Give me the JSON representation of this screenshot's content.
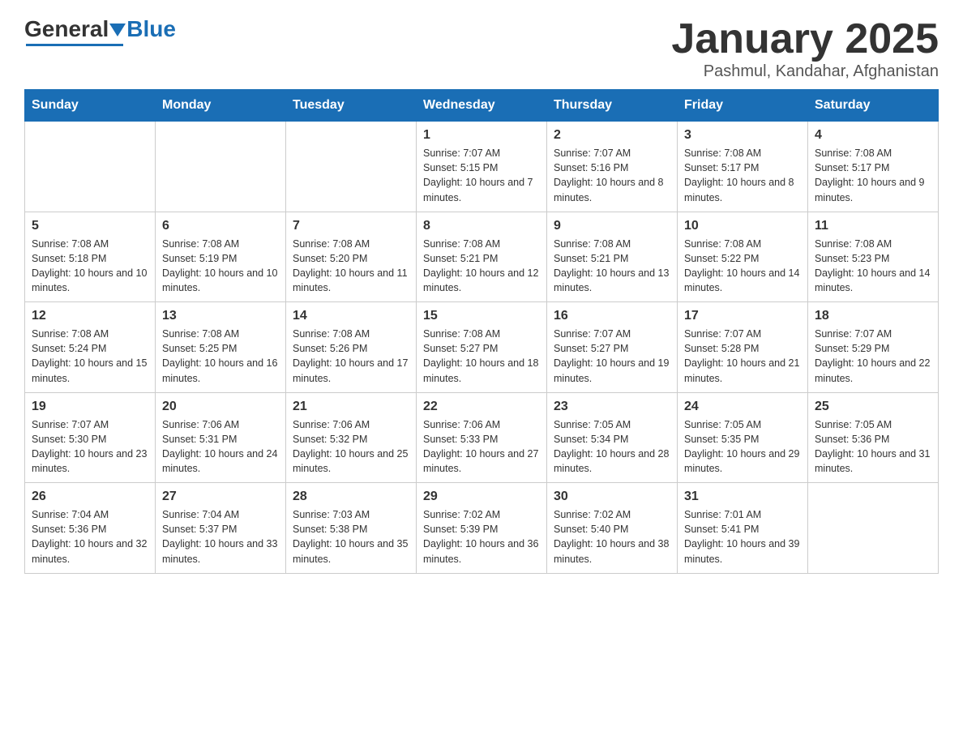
{
  "header": {
    "logo_general": "General",
    "logo_blue": "Blue",
    "title": "January 2025",
    "location": "Pashmul, Kandahar, Afghanistan"
  },
  "days_of_week": [
    "Sunday",
    "Monday",
    "Tuesday",
    "Wednesday",
    "Thursday",
    "Friday",
    "Saturday"
  ],
  "weeks": [
    [
      {
        "day": "",
        "info": ""
      },
      {
        "day": "",
        "info": ""
      },
      {
        "day": "",
        "info": ""
      },
      {
        "day": "1",
        "info": "Sunrise: 7:07 AM\nSunset: 5:15 PM\nDaylight: 10 hours and 7 minutes."
      },
      {
        "day": "2",
        "info": "Sunrise: 7:07 AM\nSunset: 5:16 PM\nDaylight: 10 hours and 8 minutes."
      },
      {
        "day": "3",
        "info": "Sunrise: 7:08 AM\nSunset: 5:17 PM\nDaylight: 10 hours and 8 minutes."
      },
      {
        "day": "4",
        "info": "Sunrise: 7:08 AM\nSunset: 5:17 PM\nDaylight: 10 hours and 9 minutes."
      }
    ],
    [
      {
        "day": "5",
        "info": "Sunrise: 7:08 AM\nSunset: 5:18 PM\nDaylight: 10 hours and 10 minutes."
      },
      {
        "day": "6",
        "info": "Sunrise: 7:08 AM\nSunset: 5:19 PM\nDaylight: 10 hours and 10 minutes."
      },
      {
        "day": "7",
        "info": "Sunrise: 7:08 AM\nSunset: 5:20 PM\nDaylight: 10 hours and 11 minutes."
      },
      {
        "day": "8",
        "info": "Sunrise: 7:08 AM\nSunset: 5:21 PM\nDaylight: 10 hours and 12 minutes."
      },
      {
        "day": "9",
        "info": "Sunrise: 7:08 AM\nSunset: 5:21 PM\nDaylight: 10 hours and 13 minutes."
      },
      {
        "day": "10",
        "info": "Sunrise: 7:08 AM\nSunset: 5:22 PM\nDaylight: 10 hours and 14 minutes."
      },
      {
        "day": "11",
        "info": "Sunrise: 7:08 AM\nSunset: 5:23 PM\nDaylight: 10 hours and 14 minutes."
      }
    ],
    [
      {
        "day": "12",
        "info": "Sunrise: 7:08 AM\nSunset: 5:24 PM\nDaylight: 10 hours and 15 minutes."
      },
      {
        "day": "13",
        "info": "Sunrise: 7:08 AM\nSunset: 5:25 PM\nDaylight: 10 hours and 16 minutes."
      },
      {
        "day": "14",
        "info": "Sunrise: 7:08 AM\nSunset: 5:26 PM\nDaylight: 10 hours and 17 minutes."
      },
      {
        "day": "15",
        "info": "Sunrise: 7:08 AM\nSunset: 5:27 PM\nDaylight: 10 hours and 18 minutes."
      },
      {
        "day": "16",
        "info": "Sunrise: 7:07 AM\nSunset: 5:27 PM\nDaylight: 10 hours and 19 minutes."
      },
      {
        "day": "17",
        "info": "Sunrise: 7:07 AM\nSunset: 5:28 PM\nDaylight: 10 hours and 21 minutes."
      },
      {
        "day": "18",
        "info": "Sunrise: 7:07 AM\nSunset: 5:29 PM\nDaylight: 10 hours and 22 minutes."
      }
    ],
    [
      {
        "day": "19",
        "info": "Sunrise: 7:07 AM\nSunset: 5:30 PM\nDaylight: 10 hours and 23 minutes."
      },
      {
        "day": "20",
        "info": "Sunrise: 7:06 AM\nSunset: 5:31 PM\nDaylight: 10 hours and 24 minutes."
      },
      {
        "day": "21",
        "info": "Sunrise: 7:06 AM\nSunset: 5:32 PM\nDaylight: 10 hours and 25 minutes."
      },
      {
        "day": "22",
        "info": "Sunrise: 7:06 AM\nSunset: 5:33 PM\nDaylight: 10 hours and 27 minutes."
      },
      {
        "day": "23",
        "info": "Sunrise: 7:05 AM\nSunset: 5:34 PM\nDaylight: 10 hours and 28 minutes."
      },
      {
        "day": "24",
        "info": "Sunrise: 7:05 AM\nSunset: 5:35 PM\nDaylight: 10 hours and 29 minutes."
      },
      {
        "day": "25",
        "info": "Sunrise: 7:05 AM\nSunset: 5:36 PM\nDaylight: 10 hours and 31 minutes."
      }
    ],
    [
      {
        "day": "26",
        "info": "Sunrise: 7:04 AM\nSunset: 5:36 PM\nDaylight: 10 hours and 32 minutes."
      },
      {
        "day": "27",
        "info": "Sunrise: 7:04 AM\nSunset: 5:37 PM\nDaylight: 10 hours and 33 minutes."
      },
      {
        "day": "28",
        "info": "Sunrise: 7:03 AM\nSunset: 5:38 PM\nDaylight: 10 hours and 35 minutes."
      },
      {
        "day": "29",
        "info": "Sunrise: 7:02 AM\nSunset: 5:39 PM\nDaylight: 10 hours and 36 minutes."
      },
      {
        "day": "30",
        "info": "Sunrise: 7:02 AM\nSunset: 5:40 PM\nDaylight: 10 hours and 38 minutes."
      },
      {
        "day": "31",
        "info": "Sunrise: 7:01 AM\nSunset: 5:41 PM\nDaylight: 10 hours and 39 minutes."
      },
      {
        "day": "",
        "info": ""
      }
    ]
  ]
}
